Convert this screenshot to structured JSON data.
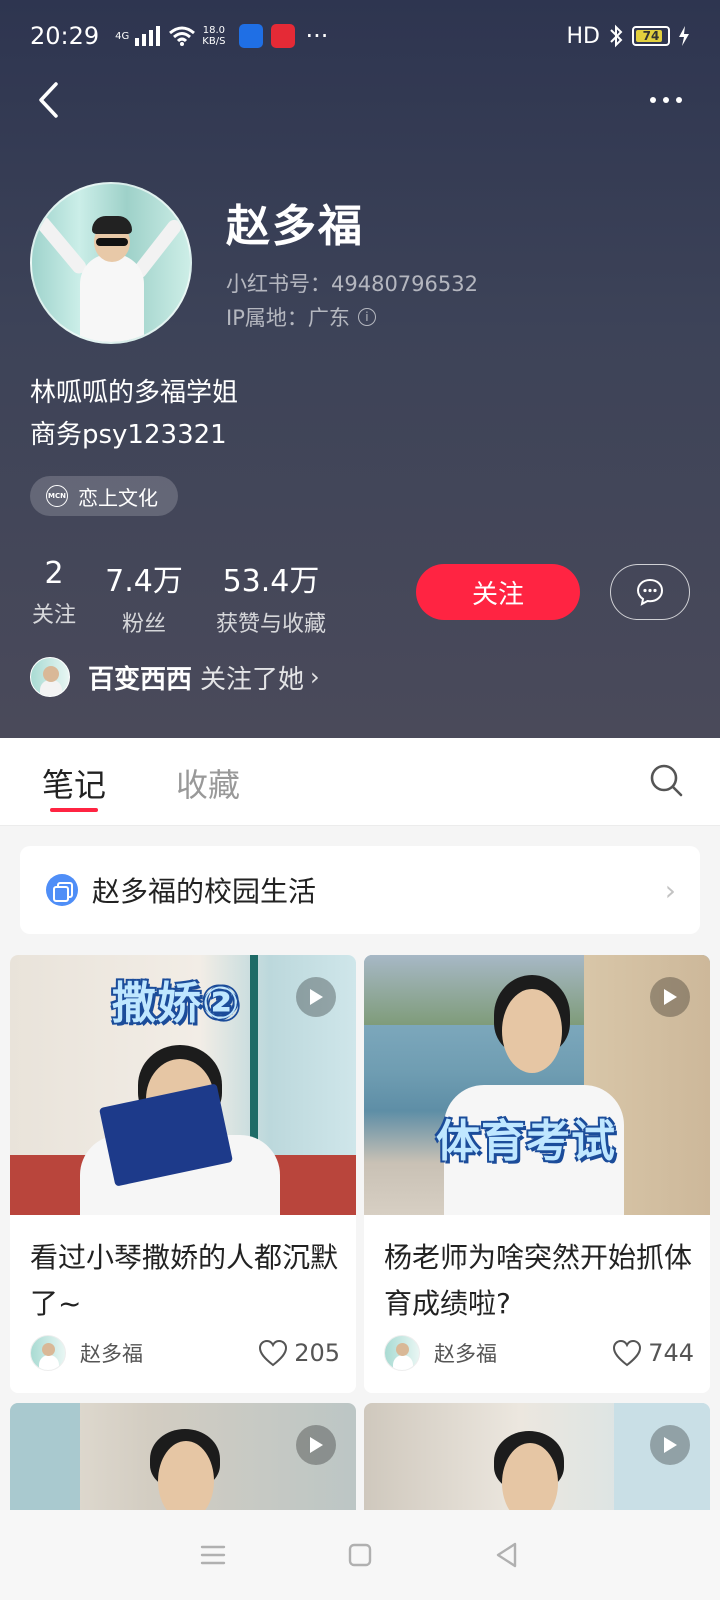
{
  "status_bar": {
    "time": "20:29",
    "network_type": "4G",
    "speed_value": "18.0",
    "speed_unit": "KB/S",
    "more": "···",
    "hd": "HD",
    "battery": "74",
    "app_icon_colors": [
      "#1f6fe5",
      "#e52a36"
    ]
  },
  "profile": {
    "name": "赵多福",
    "id_label": "小红书号：49480796532",
    "ip_label": "IP属地：广东",
    "bio_line1": "林呱呱的多福学姐",
    "bio_line2": "商务psy123321",
    "mcn_icon_text": "MCN",
    "mcn_name": "恋上文化"
  },
  "stats": [
    {
      "num": "2",
      "label": "关注"
    },
    {
      "num": "7.4万",
      "label": "粉丝"
    },
    {
      "num": "53.4万",
      "label": "获赞与收藏"
    }
  ],
  "actions": {
    "follow_label": "关注"
  },
  "followed_by": {
    "name": "百变西西",
    "text": "关注了她",
    "chevron": "›"
  },
  "tabs": [
    {
      "label": "笔记",
      "active": true
    },
    {
      "label": "收藏",
      "active": false
    }
  ],
  "collection": {
    "title": "赵多福的校园生活",
    "chevron": "›"
  },
  "notes": [
    {
      "overlay": "撒娇②",
      "title": "看过小琴撒娇的人都沉默了~",
      "author": "赵多福",
      "likes": "205"
    },
    {
      "overlay": "体育考试",
      "title": "杨老师为啥突然开始抓体育成绩啦?",
      "author": "赵多福",
      "likes": "744"
    },
    {
      "overlay": "",
      "title": "",
      "author": "",
      "likes": ""
    },
    {
      "overlay": "",
      "title": "",
      "author": "",
      "likes": ""
    }
  ],
  "colors": {
    "accent": "#ff2442",
    "header_bg": "#3d4358",
    "collection_icon": "#4f8ef7"
  },
  "icons": {
    "back": "back-arrow-icon",
    "more": "more-dots-icon",
    "message": "chat-bubble-icon",
    "search": "search-icon",
    "play": "play-icon",
    "like": "heart-icon",
    "info": "info-icon"
  }
}
